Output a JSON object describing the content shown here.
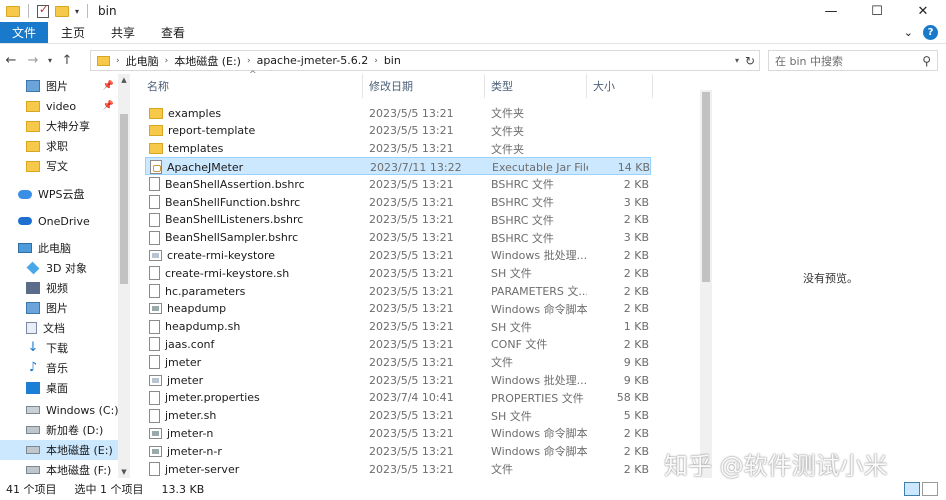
{
  "window": {
    "title": "bin"
  },
  "ribbon": {
    "tabs": [
      "文件",
      "主页",
      "共享",
      "查看"
    ],
    "active": "文件"
  },
  "address": {
    "crumbs": [
      "此电脑",
      "本地磁盘 (E:)",
      "apache-jmeter-5.6.2",
      "bin"
    ],
    "search_placeholder": "在 bin 中搜索"
  },
  "nav": {
    "items": [
      {
        "label": "图片",
        "icon": "pictures-icon",
        "pinned": true
      },
      {
        "label": "video",
        "icon": "folder-icon",
        "pinned": true
      },
      {
        "label": "大神分享",
        "icon": "folder-icon"
      },
      {
        "label": "求职",
        "icon": "folder-icon"
      },
      {
        "label": "写文",
        "icon": "folder-icon"
      },
      {
        "label": "WPS云盘",
        "icon": "wps-cloud-icon"
      },
      {
        "label": "OneDrive",
        "icon": "onedrive-icon"
      },
      {
        "label": "此电脑",
        "icon": "this-pc-icon"
      },
      {
        "label": "3D 对象",
        "icon": "3d-objects-icon"
      },
      {
        "label": "视频",
        "icon": "videos-icon"
      },
      {
        "label": "图片",
        "icon": "pictures-icon"
      },
      {
        "label": "文档",
        "icon": "documents-icon"
      },
      {
        "label": "下载",
        "icon": "downloads-icon"
      },
      {
        "label": "音乐",
        "icon": "music-icon"
      },
      {
        "label": "桌面",
        "icon": "desktop-icon"
      },
      {
        "label": "Windows (C:)",
        "icon": "windows-drive-icon"
      },
      {
        "label": "新加卷 (D:)",
        "icon": "drive-icon"
      },
      {
        "label": "本地磁盘 (E:)",
        "icon": "drive-icon",
        "selected": true
      },
      {
        "label": "本地磁盘 (F:)",
        "icon": "drive-icon"
      }
    ]
  },
  "columns": {
    "name": "名称",
    "date": "修改日期",
    "type": "类型",
    "size": "大小"
  },
  "files": [
    {
      "name": "examples",
      "date": "2023/5/5 13:21",
      "type": "文件夹",
      "size": "",
      "icon": "folder-icon"
    },
    {
      "name": "report-template",
      "date": "2023/5/5 13:21",
      "type": "文件夹",
      "size": "",
      "icon": "folder-icon"
    },
    {
      "name": "templates",
      "date": "2023/5/5 13:21",
      "type": "文件夹",
      "size": "",
      "icon": "folder-icon"
    },
    {
      "name": "ApacheJMeter",
      "date": "2023/7/11 13:22",
      "type": "Executable Jar File",
      "size": "14 KB",
      "icon": "jar-file-icon",
      "selected": true
    },
    {
      "name": "BeanShellAssertion.bshrc",
      "date": "2023/5/5 13:21",
      "type": "BSHRC 文件",
      "size": "2 KB",
      "icon": "file-icon"
    },
    {
      "name": "BeanShellFunction.bshrc",
      "date": "2023/5/5 13:21",
      "type": "BSHRC 文件",
      "size": "3 KB",
      "icon": "file-icon"
    },
    {
      "name": "BeanShellListeners.bshrc",
      "date": "2023/5/5 13:21",
      "type": "BSHRC 文件",
      "size": "2 KB",
      "icon": "file-icon"
    },
    {
      "name": "BeanShellSampler.bshrc",
      "date": "2023/5/5 13:21",
      "type": "BSHRC 文件",
      "size": "3 KB",
      "icon": "file-icon"
    },
    {
      "name": "create-rmi-keystore",
      "date": "2023/5/5 13:21",
      "type": "Windows 批处理...",
      "size": "2 KB",
      "icon": "batch-file-icon"
    },
    {
      "name": "create-rmi-keystore.sh",
      "date": "2023/5/5 13:21",
      "type": "SH 文件",
      "size": "2 KB",
      "icon": "file-icon"
    },
    {
      "name": "hc.parameters",
      "date": "2023/5/5 13:21",
      "type": "PARAMETERS 文...",
      "size": "2 KB",
      "icon": "file-icon"
    },
    {
      "name": "heapdump",
      "date": "2023/5/5 13:21",
      "type": "Windows 命令脚本",
      "size": "2 KB",
      "icon": "cmd-file-icon"
    },
    {
      "name": "heapdump.sh",
      "date": "2023/5/5 13:21",
      "type": "SH 文件",
      "size": "1 KB",
      "icon": "file-icon"
    },
    {
      "name": "jaas.conf",
      "date": "2023/5/5 13:21",
      "type": "CONF 文件",
      "size": "2 KB",
      "icon": "file-icon"
    },
    {
      "name": "jmeter",
      "date": "2023/5/5 13:21",
      "type": "文件",
      "size": "9 KB",
      "icon": "file-icon"
    },
    {
      "name": "jmeter",
      "date": "2023/5/5 13:21",
      "type": "Windows 批处理...",
      "size": "9 KB",
      "icon": "batch-file-icon"
    },
    {
      "name": "jmeter.properties",
      "date": "2023/7/4 10:41",
      "type": "PROPERTIES 文件",
      "size": "58 KB",
      "icon": "file-icon"
    },
    {
      "name": "jmeter.sh",
      "date": "2023/5/5 13:21",
      "type": "SH 文件",
      "size": "5 KB",
      "icon": "file-icon"
    },
    {
      "name": "jmeter-n",
      "date": "2023/5/5 13:21",
      "type": "Windows 命令脚本",
      "size": "2 KB",
      "icon": "cmd-file-icon"
    },
    {
      "name": "jmeter-n-r",
      "date": "2023/5/5 13:21",
      "type": "Windows 命令脚本",
      "size": "2 KB",
      "icon": "cmd-file-icon"
    },
    {
      "name": "jmeter-server",
      "date": "2023/5/5 13:21",
      "type": "文件",
      "size": "2 KB",
      "icon": "file-icon"
    }
  ],
  "preview": {
    "message": "没有预览。"
  },
  "status": {
    "count": "41 个项目",
    "selected": "选中 1 个项目",
    "size": "13.3 KB"
  },
  "watermark": "知乎 @软件测试小米"
}
